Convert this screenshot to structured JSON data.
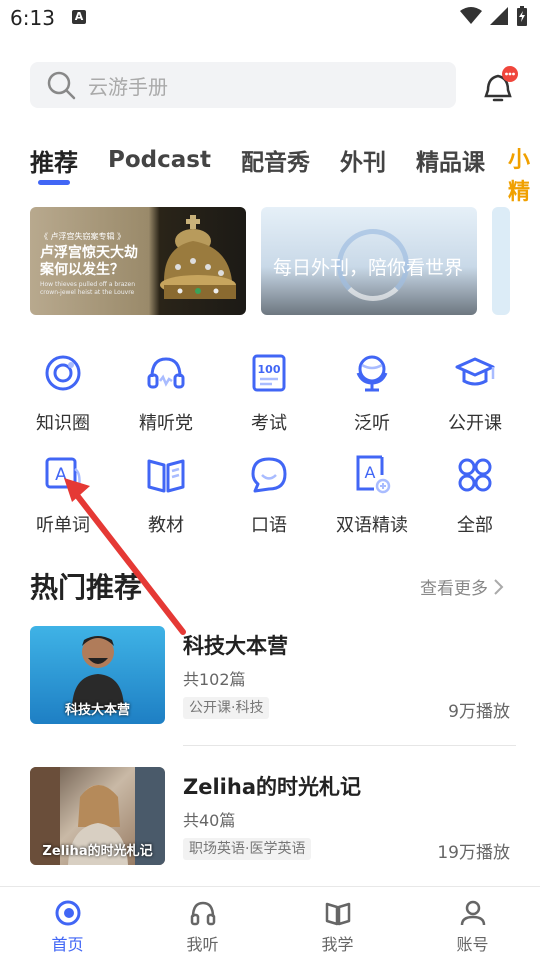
{
  "status": {
    "time": "6:13",
    "notif_letter": "A"
  },
  "search": {
    "placeholder": "云游手册"
  },
  "tabs": [
    {
      "label": "推荐",
      "active": true
    },
    {
      "label": "Podcast"
    },
    {
      "label": "配音秀"
    },
    {
      "label": "外刊"
    },
    {
      "label": "精品课"
    }
  ],
  "tab_overflow": "小精",
  "banners": {
    "b1_sub": "《 卢浮宫失窃案专辑 》",
    "b1_title": "卢浮宫惊天大劫案何以发生？",
    "b1_small": "How thieves pulled off a brazen crown-jewel heist at the Louvre",
    "b2_text": "每日外刊，陪你看世界"
  },
  "grid": [
    {
      "label": "知识圈",
      "icon": "knowledge-circle-icon"
    },
    {
      "label": "精听党",
      "icon": "headset-icon"
    },
    {
      "label": "考试",
      "icon": "exam-100-icon"
    },
    {
      "label": "泛听",
      "icon": "globe-icon"
    },
    {
      "label": "公开课",
      "icon": "graduation-cap-icon"
    },
    {
      "label": "听单词",
      "icon": "word-card-icon"
    },
    {
      "label": "教材",
      "icon": "textbook-icon"
    },
    {
      "label": "口语",
      "icon": "speech-bubble-icon"
    },
    {
      "label": "双语精读",
      "icon": "bilingual-read-icon"
    },
    {
      "label": "全部",
      "icon": "all-grid-icon"
    }
  ],
  "section": {
    "title": "热门推荐",
    "more": "查看更多"
  },
  "cards": [
    {
      "title": "科技大本营",
      "count": "共102篇",
      "tag": "公开课·科技",
      "plays": "9万播放",
      "thumb_caption": "科技大本营"
    },
    {
      "title": "Zeliha的时光札记",
      "count": "共40篇",
      "tag": "职场英语·医学英语",
      "plays": "19万播放",
      "thumb_caption": "Zeliha的时光札记"
    }
  ],
  "nav": [
    {
      "label": "首页",
      "icon": "home-icon",
      "active": true
    },
    {
      "label": "我听",
      "icon": "headphones-icon"
    },
    {
      "label": "我学",
      "icon": "book-icon"
    },
    {
      "label": "账号",
      "icon": "person-icon"
    }
  ],
  "colors": {
    "accent": "#4166f5",
    "arrow": "#e53935"
  }
}
